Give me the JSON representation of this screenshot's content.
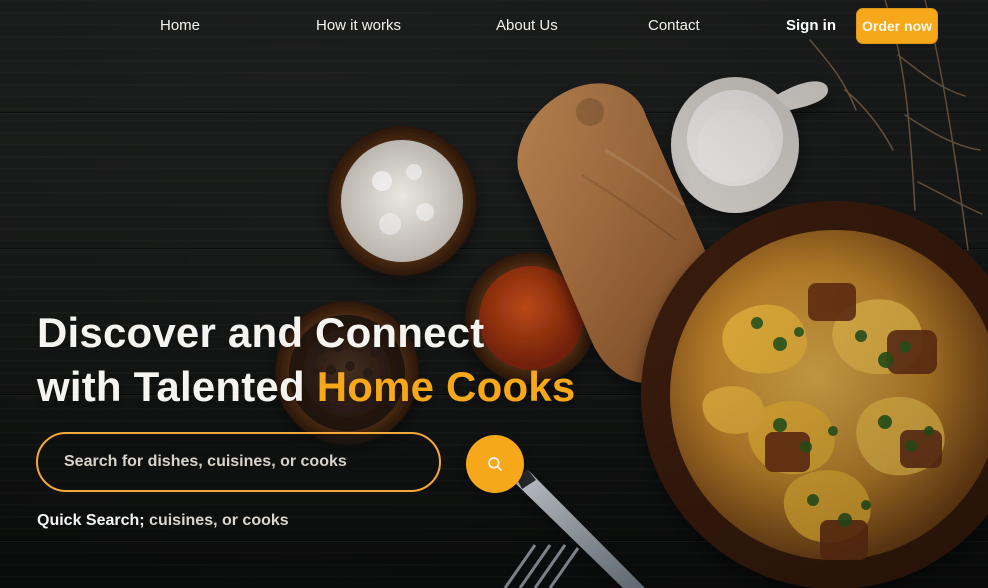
{
  "nav": {
    "links": [
      {
        "label": "Home"
      },
      {
        "label": "How it works"
      },
      {
        "label": "About Us"
      },
      {
        "label": "Contact"
      }
    ],
    "signin_label": "Sign in",
    "order_label": "Order now"
  },
  "hero": {
    "title_line_1": "Discover and Connect",
    "title_line_2_prefix": "with Talented ",
    "title_line_2_accent": "Home Cooks"
  },
  "search": {
    "placeholder": "Search for dishes, cuisines, or cooks"
  },
  "quick_search": {
    "label": "Quick Search;",
    "text": " cuisines, or cooks"
  },
  "colors": {
    "accent": "#f6a71a",
    "background": "#1a1c1b",
    "text": "#f4f4f4"
  }
}
